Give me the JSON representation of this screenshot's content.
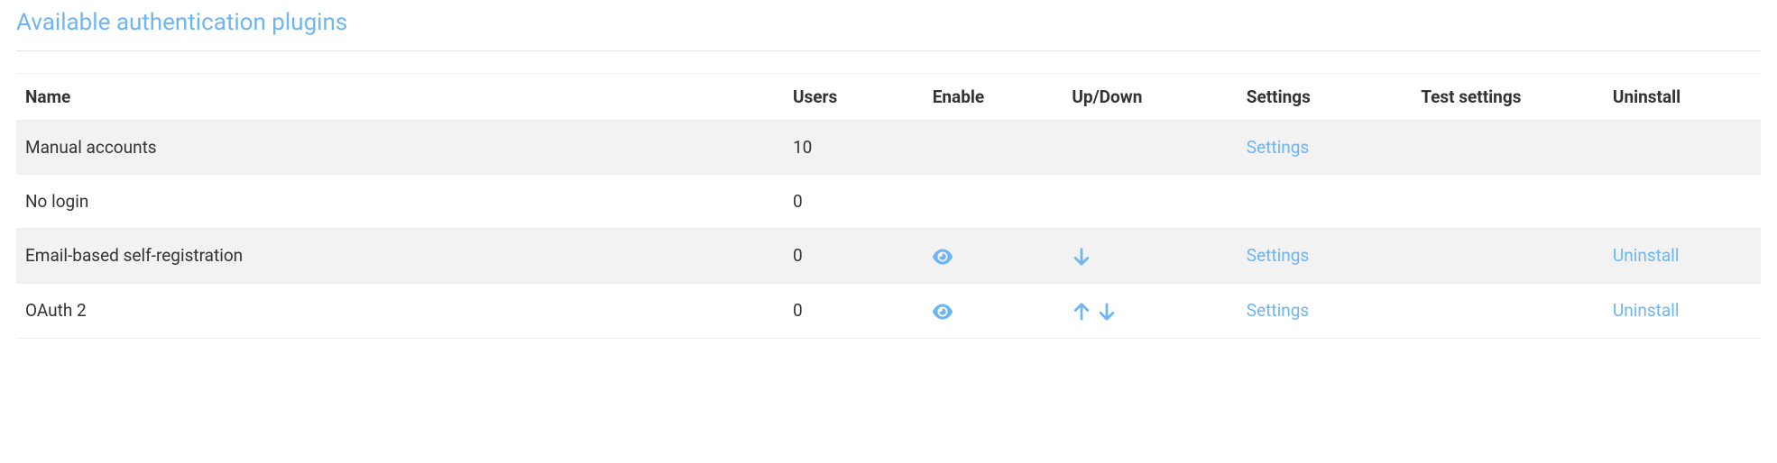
{
  "section": {
    "title": "Available authentication plugins"
  },
  "table": {
    "headers": {
      "name": "Name",
      "users": "Users",
      "enable": "Enable",
      "updown": "Up/Down",
      "settings": "Settings",
      "test": "Test settings",
      "uninstall": "Uninstall"
    },
    "rows": [
      {
        "name": "Manual accounts",
        "users": "10",
        "enable": null,
        "up": false,
        "down": false,
        "settings": "Settings",
        "test": null,
        "uninstall": null
      },
      {
        "name": "No login",
        "users": "0",
        "enable": null,
        "up": false,
        "down": false,
        "settings": null,
        "test": null,
        "uninstall": null
      },
      {
        "name": "Email-based self-registration",
        "users": "0",
        "enable": "eye",
        "up": false,
        "down": true,
        "settings": "Settings",
        "test": null,
        "uninstall": "Uninstall"
      },
      {
        "name": "OAuth 2",
        "users": "0",
        "enable": "eye",
        "up": true,
        "down": true,
        "settings": "Settings",
        "test": null,
        "uninstall": "Uninstall"
      }
    ]
  },
  "icons": {
    "eye": "eye-icon",
    "up": "arrow-up-icon",
    "down": "arrow-down-icon"
  }
}
